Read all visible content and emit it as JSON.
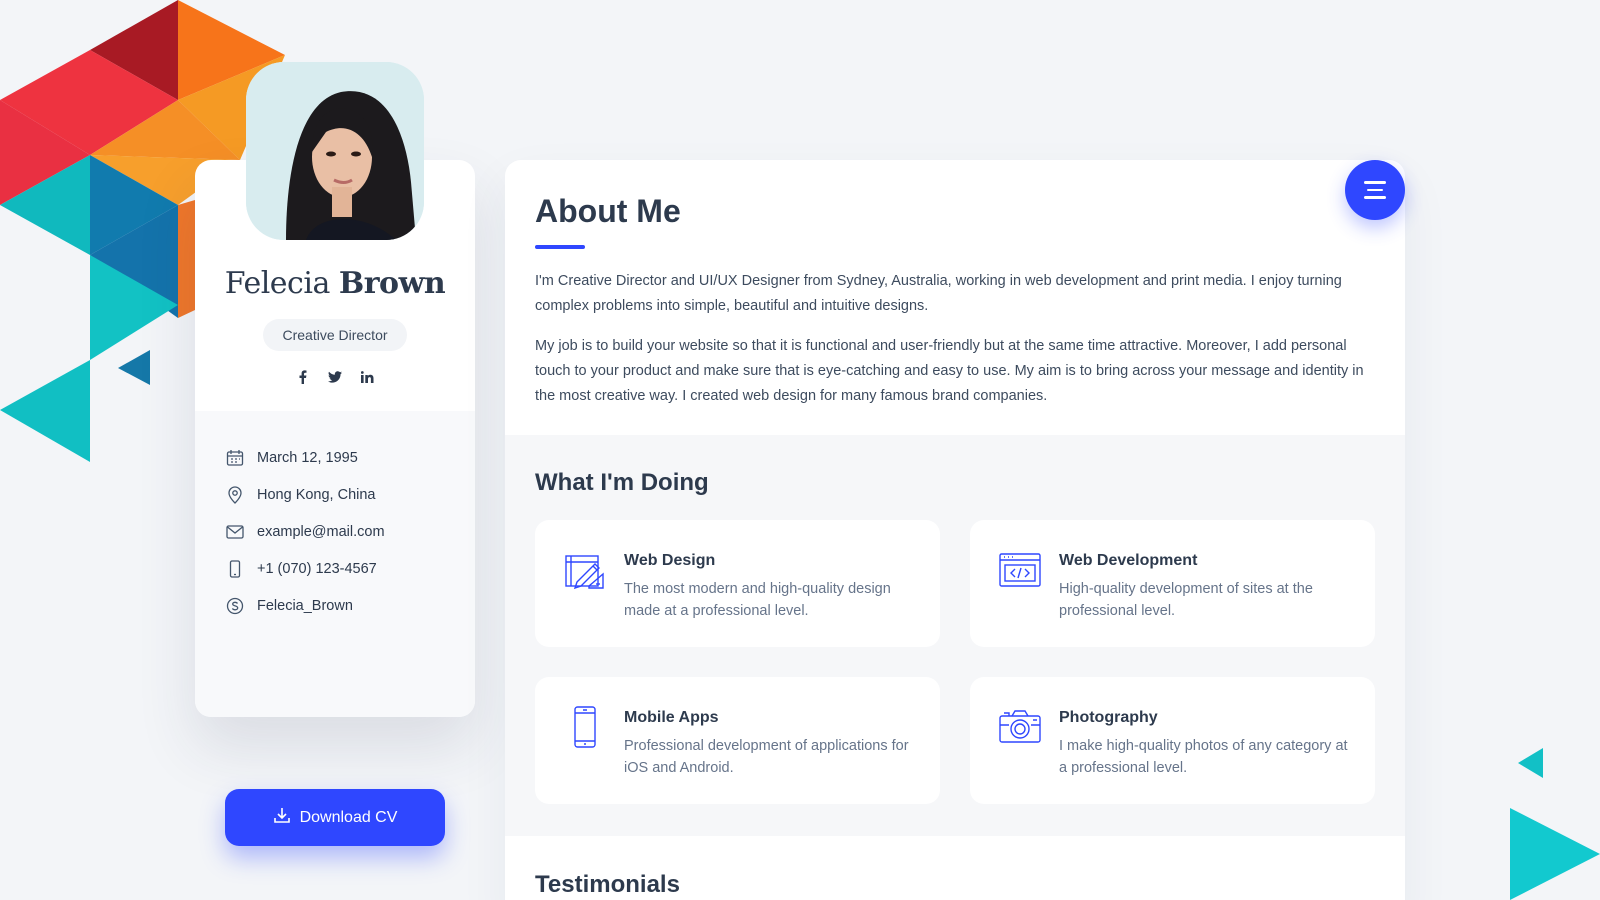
{
  "profile": {
    "first_name": "Felecia",
    "last_name": "Brown",
    "role": "Creative Director",
    "social": [
      "facebook-icon",
      "twitter-icon",
      "linkedin-icon"
    ],
    "info": [
      {
        "icon": "calendar-icon",
        "text": "March 12, 1995"
      },
      {
        "icon": "location-icon",
        "text": "Hong Kong, China"
      },
      {
        "icon": "mail-icon",
        "text": "example@mail.com"
      },
      {
        "icon": "phone-icon",
        "text": "+1 (070) 123-4567"
      },
      {
        "icon": "skype-icon",
        "text": "Felecia_Brown"
      }
    ],
    "download_label": "Download CV"
  },
  "about": {
    "title": "About Me",
    "paragraphs": [
      "I'm Creative Director and UI/UX Designer from Sydney, Australia, working in web development and print media. I enjoy turning complex problems into simple, beautiful and intuitive designs.",
      "My job is to build your website so that it is functional and user-friendly but at the same time attractive. Moreover, I add personal touch to your product and make sure that is eye-catching and easy to use. My aim is to bring across your message and identity in the most creative way. I created web design for many famous brand companies."
    ]
  },
  "doing": {
    "title": "What I'm Doing",
    "services": [
      {
        "icon": "design-icon",
        "title": "Web Design",
        "text": "The most modern and high-quality design made at a professional level."
      },
      {
        "icon": "code-icon",
        "title": "Web Development",
        "text": "High-quality development of sites at the professional level."
      },
      {
        "icon": "mobile-icon",
        "title": "Mobile Apps",
        "text": "Professional development of applications for iOS and Android."
      },
      {
        "icon": "camera-icon",
        "title": "Photography",
        "text": "I make high-quality photos of any category at a professional level."
      }
    ]
  },
  "testimonials": {
    "title": "Testimonials"
  },
  "colors": {
    "accent": "#2f47ff",
    "heading": "#2d3a4d",
    "teal": "#14c4c8"
  }
}
